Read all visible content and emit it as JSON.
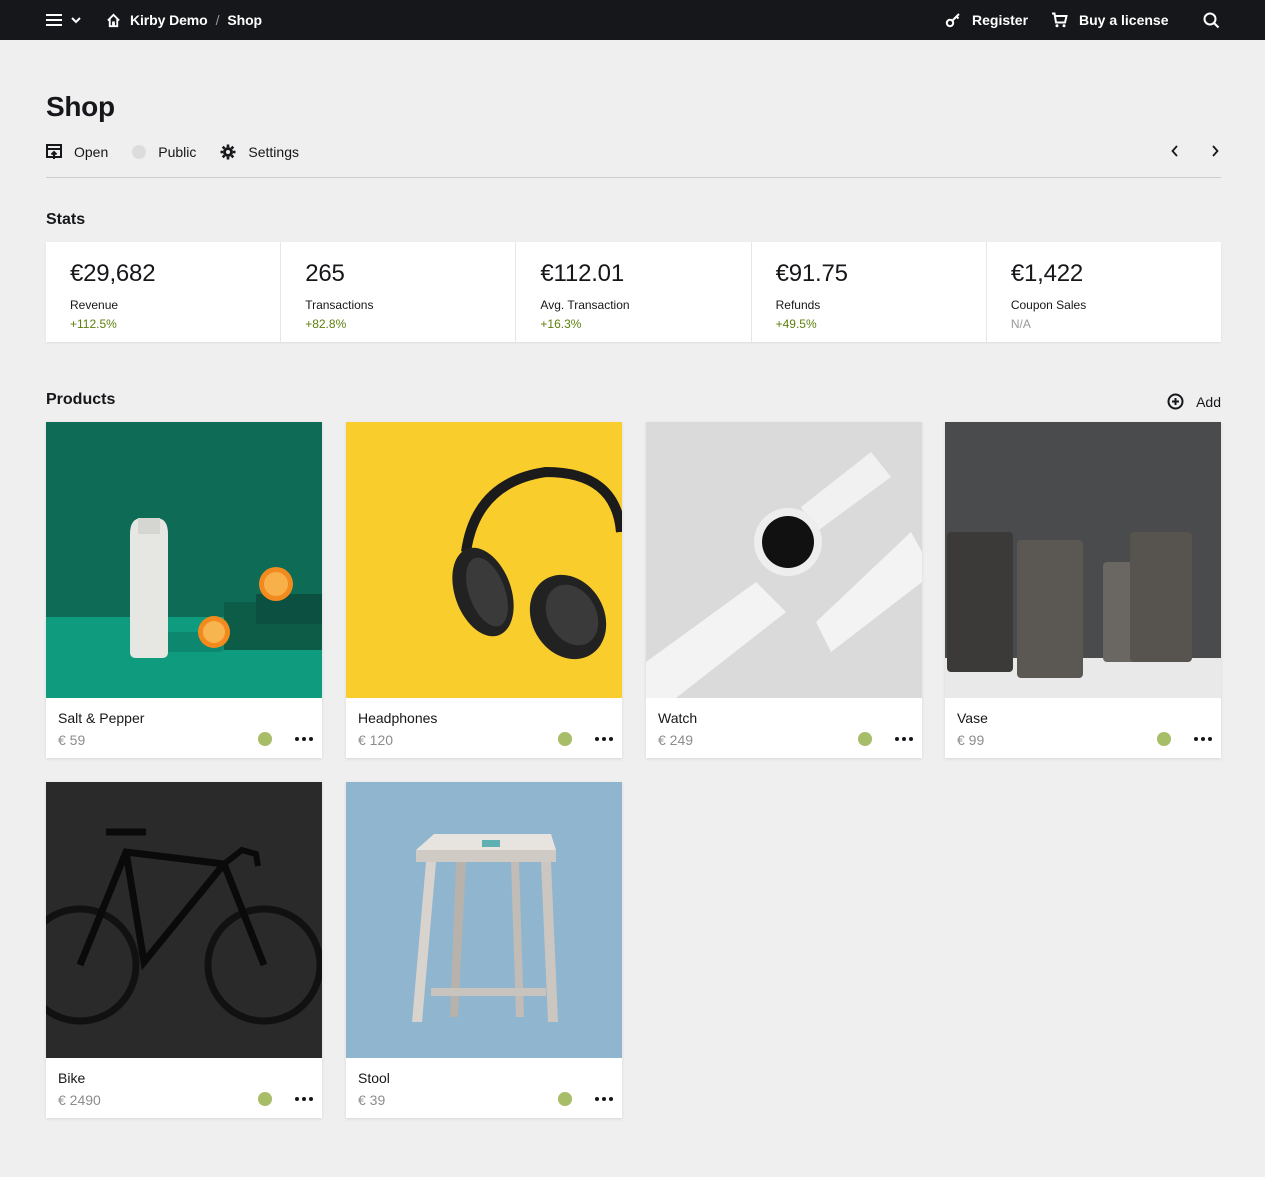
{
  "topbar": {
    "site": "Kirby Demo",
    "crumb": "Shop",
    "register": "Register",
    "buy": "Buy a license"
  },
  "header": {
    "title": "Shop",
    "open": "Open",
    "status": "Public",
    "settings": "Settings"
  },
  "stats": {
    "label": "Stats",
    "items": [
      {
        "value": "€29,682",
        "label": "Revenue",
        "info": "+112.5%"
      },
      {
        "value": "265",
        "label": "Transactions",
        "info": "+82.8%"
      },
      {
        "value": "€112.01",
        "label": "Avg. Transaction",
        "info": "+16.3%"
      },
      {
        "value": "€91.75",
        "label": "Refunds",
        "info": "+49.5%"
      },
      {
        "value": "€1,422",
        "label": "Coupon Sales",
        "info": "N/A"
      }
    ]
  },
  "products": {
    "label": "Products",
    "add": "Add",
    "items": [
      {
        "title": "Salt & Pepper",
        "price": "€ 59"
      },
      {
        "title": "Headphones",
        "price": "€ 120"
      },
      {
        "title": "Watch",
        "price": "€ 249"
      },
      {
        "title": "Vase",
        "price": "€ 99"
      },
      {
        "title": "Bike",
        "price": "€ 2490"
      },
      {
        "title": "Stool",
        "price": "€ 39"
      }
    ]
  },
  "colors": {
    "topbar": "#16171a",
    "positive": "#5d800d",
    "status_public": "#a7bd68"
  }
}
